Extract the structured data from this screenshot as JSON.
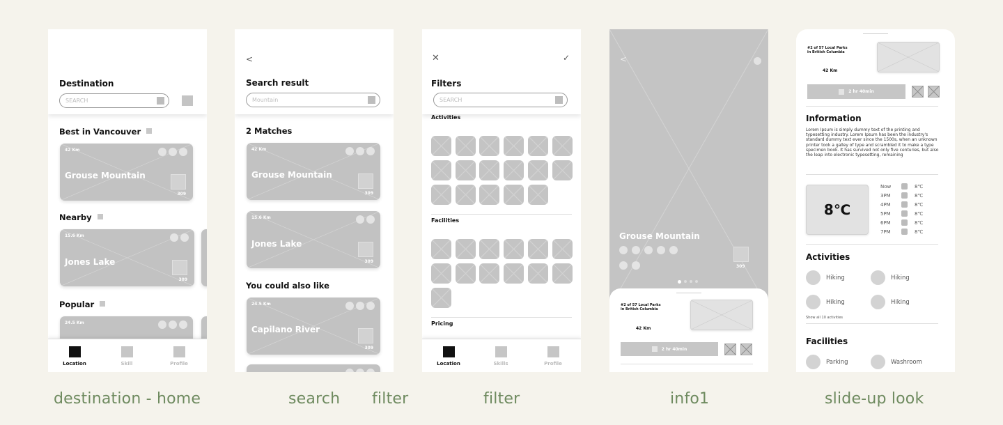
{
  "captions": [
    "destination - home",
    "search",
    "filter",
    "filter",
    "info1",
    "slide-up look"
  ],
  "nav": {
    "location": "Location",
    "skill": "Skill",
    "skills": "Skills",
    "profile": "Profile"
  },
  "home": {
    "title": "Destination",
    "search_placeholder": "SEARCH",
    "section_best": "Best in Vancouver",
    "section_nearby": "Nearby",
    "section_popular": "Popular",
    "card1": {
      "km": "42 Km",
      "name": "Grouse Mountain",
      "count": "309"
    },
    "card2": {
      "km": "15.6 Km",
      "name": "Jones Lake",
      "count": "309"
    },
    "card3": {
      "km": "24.5 Km"
    }
  },
  "search": {
    "back": "<",
    "title": "Search result",
    "query": "Mountain",
    "matches": "2 Matches",
    "card1": {
      "km": "42 Km",
      "name": "Grouse Mountain",
      "count": "309"
    },
    "card2": {
      "km": "15.6 Km",
      "name": "Jones Lake",
      "count": "309"
    },
    "also_like": "You could also like",
    "card3": {
      "km": "24.5 Km",
      "name": "Capilano River",
      "count": "309"
    }
  },
  "filter": {
    "close": "✕",
    "confirm": "✓",
    "title": "Filters",
    "search_placeholder": "SEARCH",
    "activities": "Activities",
    "facilities": "Facilities",
    "pricing": "Pricing"
  },
  "info": {
    "back": "<",
    "name": "Grouse Mountain",
    "count": "309",
    "rank_line1": "#2 of 57 Local Parks",
    "rank_line2": "in British Columbia",
    "km": "42 Km",
    "duration": "2 hr 40min"
  },
  "slide": {
    "rank_line1": "#2 of 57 Local Parks",
    "rank_line2": "in British Columbia",
    "km": "42 Km",
    "duration": "2 hr 40min",
    "information_title": "Information",
    "information_text": "Lorem Ipsum is simply dummy text of the printing and typesetting industry. Lorem Ipsum has been the industry's standard dummy text ever since the 1500s, when an unknown printer took a galley of type and scrambled it to make a type specimen book. It has survived not only five centuries, but also the leap into electronic typesetting, remaining",
    "temp_big": "8℃",
    "weather": [
      {
        "time": "Now",
        "temp": "8℃"
      },
      {
        "time": "3PM",
        "temp": "8℃"
      },
      {
        "time": "4PM",
        "temp": "8℃"
      },
      {
        "time": "5PM",
        "temp": "8℃"
      },
      {
        "time": "6PM",
        "temp": "8℃"
      },
      {
        "time": "7PM",
        "temp": "8℃"
      }
    ],
    "activities_title": "Activities",
    "activities": [
      "Hiking",
      "Hiking",
      "Hiking",
      "Hiking"
    ],
    "show_all": "Show all 10 activities",
    "facilities_title": "Facilities",
    "facilities": [
      "Parking",
      "Washroom"
    ]
  }
}
